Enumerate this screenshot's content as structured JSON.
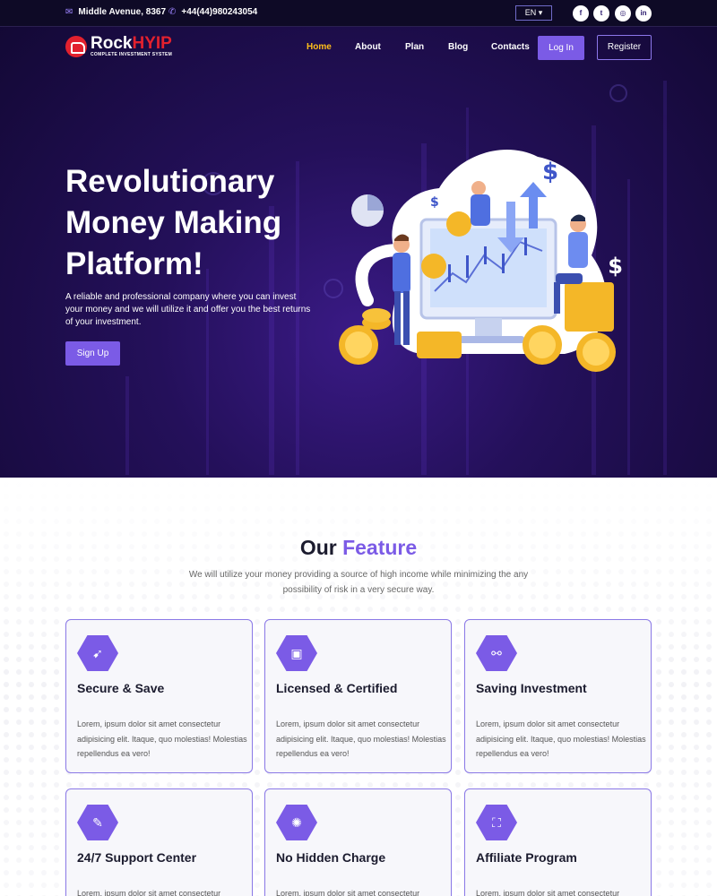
{
  "topbar": {
    "address": "Middle Avenue, 8367",
    "phone": "+44(44)980243054",
    "language": "EN",
    "social": [
      {
        "icon": "facebook-icon",
        "glyph": "f"
      },
      {
        "icon": "twitter-icon",
        "glyph": "t"
      },
      {
        "icon": "instagram-icon",
        "glyph": "◎"
      },
      {
        "icon": "linkedin-icon",
        "glyph": "in"
      }
    ]
  },
  "brand": {
    "name_main": "Rock",
    "name_accent": "HYIP",
    "tagline": "COMPLETE INVESTMENT SYSTEM",
    "accent_color": "#e2212e"
  },
  "nav": {
    "items": [
      "Home",
      "About",
      "Plan",
      "Blog",
      "Contacts"
    ],
    "active": "Home",
    "login": "Log In",
    "register": "Register"
  },
  "hero": {
    "title": "Revolutionary Money Making Platform!",
    "description": "A reliable and professional company where you can invest your money and we will utilize it and offer you the best returns of your investment.",
    "cta": "Sign Up"
  },
  "features": {
    "title_plain": "Our",
    "title_accent": "Feature",
    "subtitle": "We will utilize your money providing a source of high income while minimizing the any possibility of risk in a very secure way.",
    "cards": [
      {
        "icon": "rocket-icon",
        "glyph": "➹",
        "title": "Secure & Save",
        "text": "Lorem, ipsum dolor sit amet consectetur adipisicing elit. Itaque, quo molestias! Molestias repellendus ea vero!"
      },
      {
        "icon": "briefcase-icon",
        "glyph": "▣",
        "title": "Licensed & Certified",
        "text": "Lorem, ipsum dolor sit amet consectetur adipisicing elit. Itaque, quo molestias! Molestias repellendus ea vero!"
      },
      {
        "icon": "network-icon",
        "glyph": "⚯",
        "title": "Saving Investment",
        "text": "Lorem, ipsum dolor sit amet consectetur adipisicing elit. Itaque, quo molestias! Molestias repellendus ea vero!"
      },
      {
        "icon": "support-icon",
        "glyph": "✎",
        "title": "24/7 Support Center",
        "text": "Lorem, ipsum dolor sit amet consectetur adipisicing elit. Itaque, quo molestias! Molestias repellendus ea vero!"
      },
      {
        "icon": "globe-icon",
        "glyph": "✺",
        "title": "No Hidden Charge",
        "text": "Lorem, ipsum dolor sit amet consectetur adipisicing elit. Itaque, quo molestias! Molestias repellendus ea vero!"
      },
      {
        "icon": "expand-icon",
        "glyph": "⛶",
        "title": "Affiliate Program",
        "text": "Lorem, ipsum dolor sit amet consectetur adipisicing elit. Itaque, quo molestias! Molestias repellendus ea vero!"
      }
    ]
  },
  "colors": {
    "primary": "#7b5be6",
    "active_nav": "#ffbe1a",
    "hero_dark": "#120833"
  }
}
